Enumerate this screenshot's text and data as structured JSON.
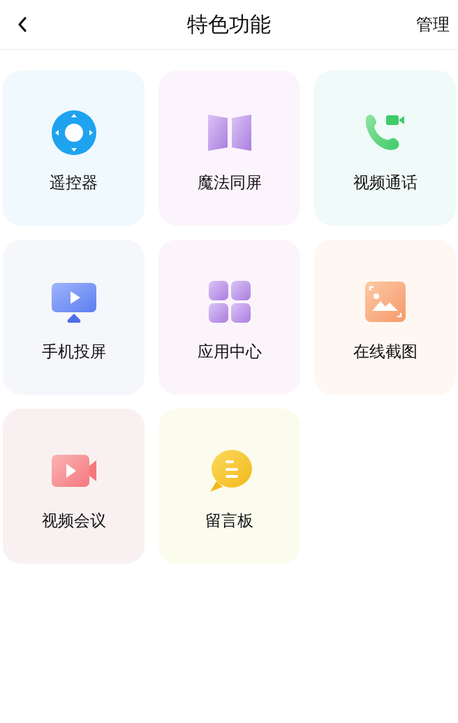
{
  "header": {
    "title": "特色功能",
    "action": "管理"
  },
  "features": [
    {
      "kind": "remote",
      "label": "遥控器"
    },
    {
      "kind": "mirror",
      "label": "魔法同屏"
    },
    {
      "kind": "videocall",
      "label": "视频通话"
    },
    {
      "kind": "cast",
      "label": "手机投屏"
    },
    {
      "kind": "apps",
      "label": "应用中心"
    },
    {
      "kind": "screenshot",
      "label": "在线截图"
    },
    {
      "kind": "meeting",
      "label": "视频会议"
    },
    {
      "kind": "board",
      "label": "留言板"
    }
  ]
}
